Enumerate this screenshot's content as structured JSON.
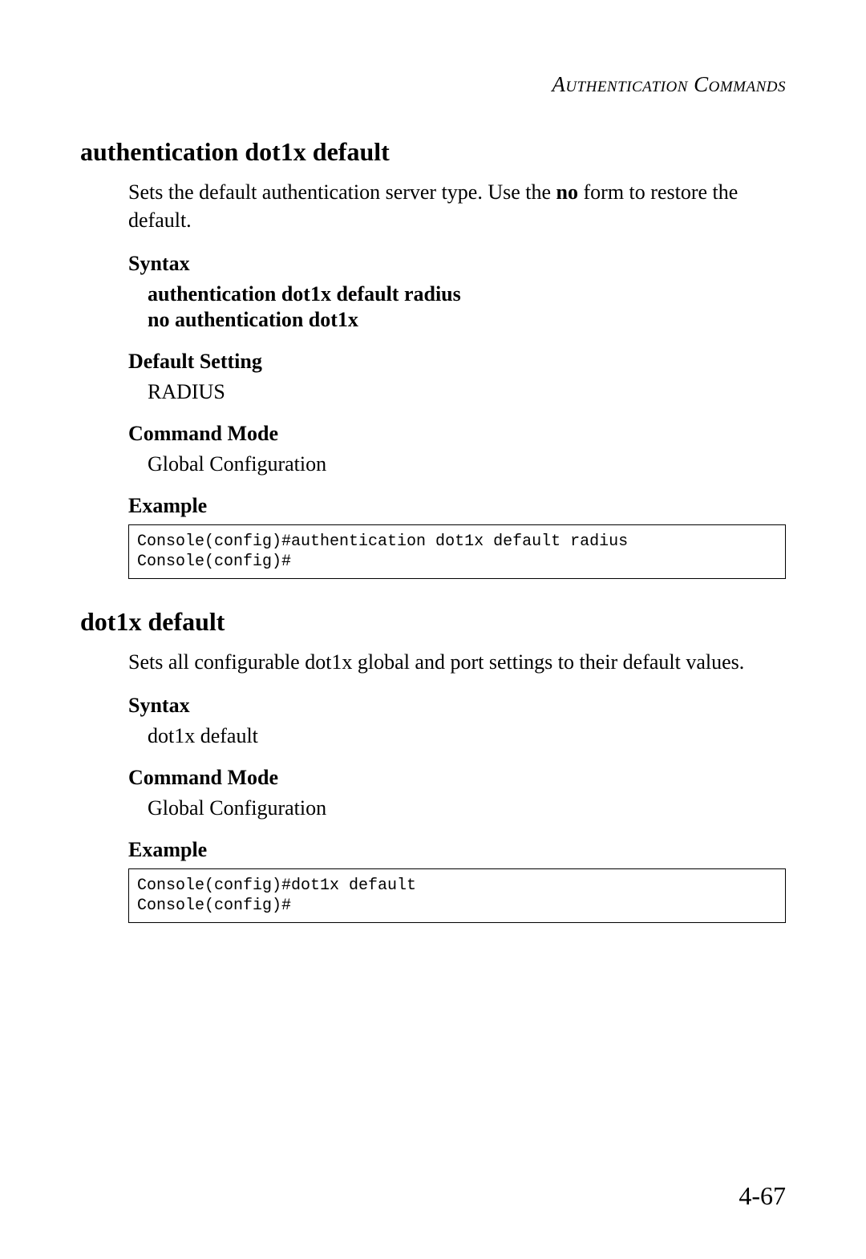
{
  "header": {
    "running_title": "Authentication Commands"
  },
  "sections": [
    {
      "title": "authentication dot1x default",
      "desc_pre": "Sets the default authentication server type. Use the ",
      "desc_bold": "no",
      "desc_post": " form to restore the default.",
      "syntax_label": "Syntax",
      "syntax_lines": [
        "authentication dot1x default radius",
        "no authentication dot1x"
      ],
      "default_label": "Default Setting",
      "default_value": "RADIUS",
      "mode_label": "Command Mode",
      "mode_value": "Global Configuration",
      "example_label": "Example",
      "example_code": "Console(config)#authentication dot1x default radius\nConsole(config)#"
    },
    {
      "title": "dot1x default",
      "desc_full": "Sets all configurable dot1x global and port settings to their default values.",
      "syntax_label": "Syntax",
      "syntax_plain": "dot1x default",
      "mode_label": "Command Mode",
      "mode_value": "Global Configuration",
      "example_label": "Example",
      "example_code": "Console(config)#dot1x default\nConsole(config)#"
    }
  ],
  "page_number": "4-67"
}
